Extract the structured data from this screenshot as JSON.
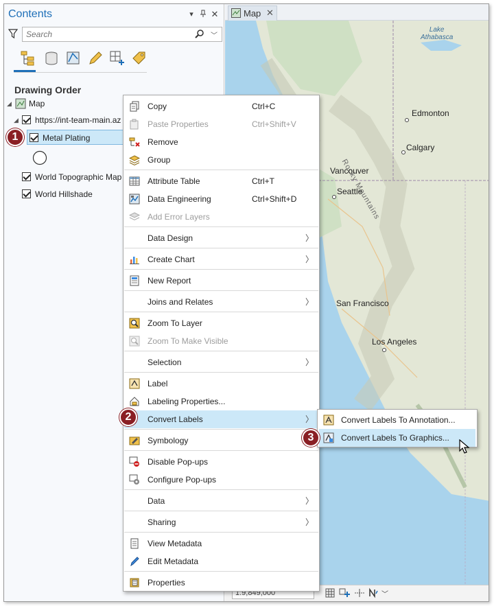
{
  "contents": {
    "title": "Contents",
    "search_placeholder": "Search",
    "section_label": "Drawing Order",
    "tree": {
      "map_label": "Map",
      "service_label": "https://int-team-main.az",
      "selected_layer": "Metal Plating",
      "layers": [
        "World Topographic Map",
        "World Hillshade"
      ]
    }
  },
  "map_tab": {
    "label": "Map",
    "scale_text": "1:9,849,000"
  },
  "map_labels": {
    "lake": "Lake\nAthabasca",
    "mountains": "Rocky Mountains",
    "cities": [
      "Edmonton",
      "Calgary",
      "Vancouver",
      "Seattle",
      "San Francisco",
      "Los Angeles"
    ]
  },
  "context_menu": {
    "items": [
      {
        "label": "Copy",
        "shortcut": "Ctrl+C"
      },
      {
        "label": "Paste Properties",
        "shortcut": "Ctrl+Shift+V"
      },
      {
        "label": "Remove"
      },
      {
        "label": "Group"
      },
      {
        "label": "Attribute Table",
        "shortcut": "Ctrl+T"
      },
      {
        "label": "Data Engineering",
        "shortcut": "Ctrl+Shift+D"
      },
      {
        "label": "Add Error Layers"
      },
      {
        "label": "Data Design"
      },
      {
        "label": "Create Chart"
      },
      {
        "label": "New Report"
      },
      {
        "label": "Joins and Relates"
      },
      {
        "label": "Zoom To Layer"
      },
      {
        "label": "Zoom To Make Visible"
      },
      {
        "label": "Selection"
      },
      {
        "label": "Label"
      },
      {
        "label": "Labeling Properties..."
      },
      {
        "label": "Convert Labels"
      },
      {
        "label": "Symbology"
      },
      {
        "label": "Disable Pop-ups"
      },
      {
        "label": "Configure Pop-ups"
      },
      {
        "label": "Data"
      },
      {
        "label": "Sharing"
      },
      {
        "label": "View Metadata"
      },
      {
        "label": "Edit Metadata"
      },
      {
        "label": "Properties"
      }
    ]
  },
  "submenu": {
    "items": [
      {
        "label": "Convert Labels To Annotation..."
      },
      {
        "label": "Convert Labels To Graphics..."
      }
    ]
  },
  "badges": [
    "1",
    "2",
    "3"
  ],
  "colors": {
    "accent": "#1e6fb8",
    "highlight": "#cce8f8",
    "badge": "#8a1f24"
  }
}
